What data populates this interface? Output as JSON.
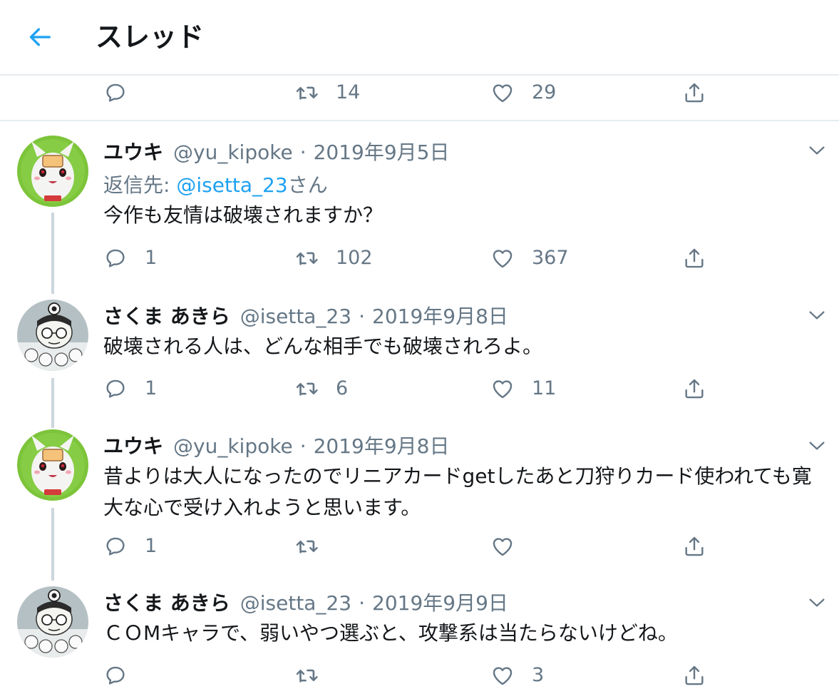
{
  "header": {
    "title": "スレッド"
  },
  "top_actions": {
    "reply": "",
    "retweet": "14",
    "like": "29"
  },
  "tweets": [
    {
      "name": "ユウキ",
      "handle": "@yu_kipoke",
      "dot": "·",
      "date": "2019年9月5日",
      "reply_prefix": "返信先: ",
      "reply_handle": "@isetta_23",
      "reply_suffix": "さん",
      "text": "今作も友情は破壊されますか？",
      "reply": "1",
      "retweet": "102",
      "like": "367"
    },
    {
      "name": "さくま あきら",
      "handle": "@isetta_23",
      "dot": "·",
      "date": "2019年9月8日",
      "text": "破壊される人は、どんな相手でも破壊されろよ。",
      "reply": "1",
      "retweet": "6",
      "like": "11"
    },
    {
      "name": "ユウキ",
      "handle": "@yu_kipoke",
      "dot": "·",
      "date": "2019年9月8日",
      "text": "昔よりは大人になったのでリニアカードgetしたあと刀狩りカード使われても寛大な心で受け入れようと思います。",
      "reply": "1",
      "retweet": "",
      "like": ""
    },
    {
      "name": "さくま あきら",
      "handle": "@isetta_23",
      "dot": "·",
      "date": "2019年9月9日",
      "text": "ＣＯMキャラで、弱いやつ選ぶと、攻撃系は当たらないけどね。",
      "reply": "",
      "retweet": "",
      "like": "3"
    }
  ],
  "colors": {
    "accent": "#1da1f2",
    "muted": "#657786",
    "divider": "#e6ecf0",
    "thread_line": "#ccd6dd"
  },
  "icons": {
    "back": "arrow-left-icon",
    "reply": "speech-bubble-icon",
    "retweet": "retweet-icon",
    "like": "heart-icon",
    "share": "share-icon",
    "more": "chevron-down-icon"
  }
}
